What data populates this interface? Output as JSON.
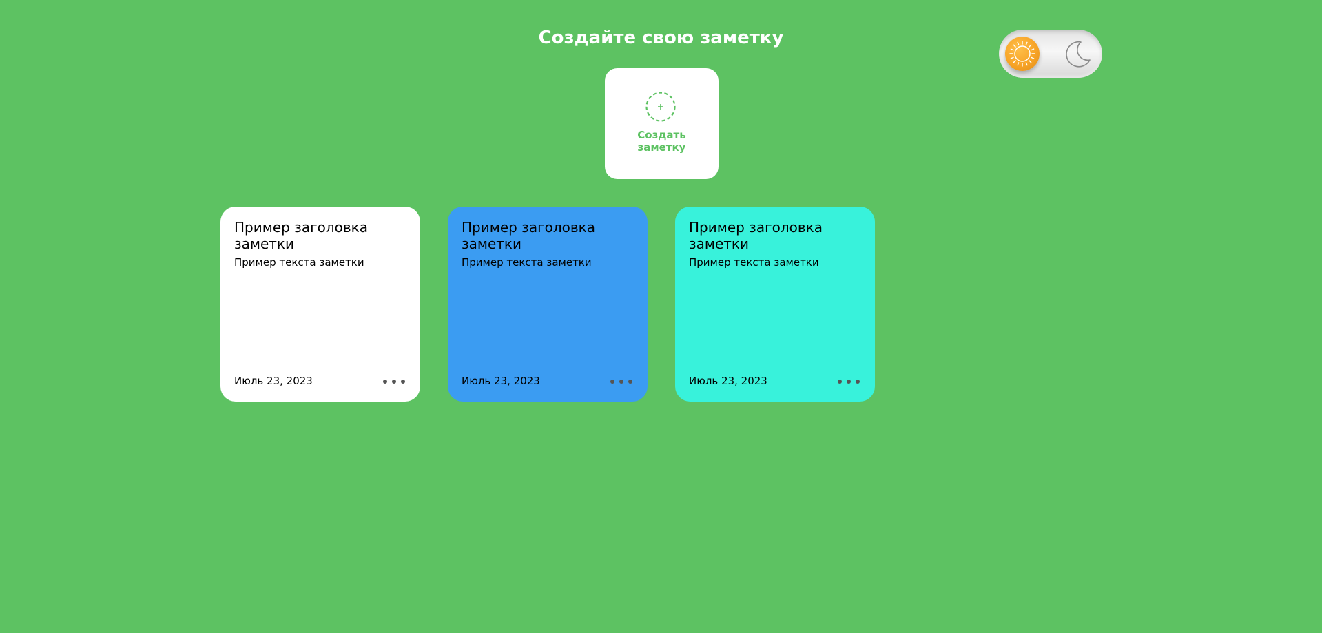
{
  "header": {
    "title": "Создайте свою заметку"
  },
  "theme_toggle": {
    "active": "light",
    "light_icon": "sun-icon",
    "dark_icon": "moon-icon",
    "knob_color": "#f7a428"
  },
  "create_card": {
    "icon": "plus-circle-icon",
    "label_line1": "Создать",
    "label_line2": "заметку"
  },
  "colors": {
    "background": "#5dc262",
    "accent": "#5dc262"
  },
  "notes": [
    {
      "title": "Пример заголовка заметки",
      "text": "Пример текста заметки",
      "date": "Июль 23, 2023",
      "color": "#ffffff",
      "menu_icon": "more-dots-icon"
    },
    {
      "title": "Пример заголовка заметки",
      "text": "Пример текста заметки",
      "date": "Июль 23, 2023",
      "color": "#3b9cf2",
      "menu_icon": "more-dots-icon"
    },
    {
      "title": "Пример заголовка заметки",
      "text": "Пример текста заметки",
      "date": "Июль 23, 2023",
      "color": "#38f2db",
      "menu_icon": "more-dots-icon"
    }
  ]
}
